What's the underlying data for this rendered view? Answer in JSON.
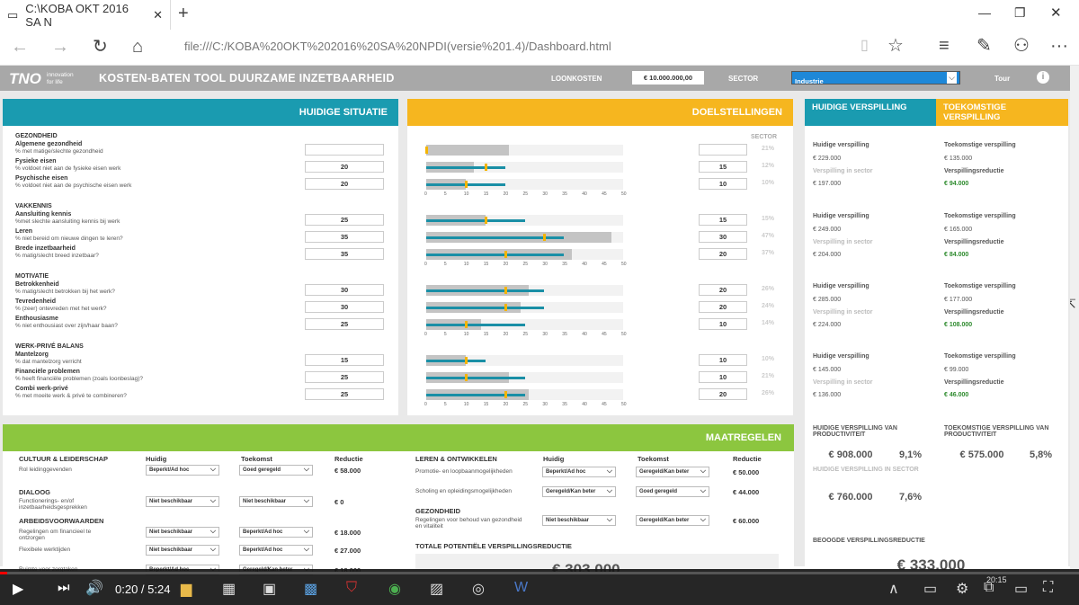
{
  "browser": {
    "tab_title": "C:\\KOBA OKT 2016 SA N",
    "url": "file:///C:/KOBA%20OKT%202016%20SA%20NPDI(versie%201.4)/Dashboard.html"
  },
  "header": {
    "logo": "TNO",
    "logo_sub1": "innovation",
    "logo_sub2": "for life",
    "title": "KOSTEN-BATEN TOOL DUURZAME INZETBAARHEID",
    "loonkosten_label": "LOONKOSTEN",
    "loonkosten_value": "€ 10.000.000,00",
    "sector_label": "SECTOR",
    "sector_value": "Industrie",
    "tour": "Tour"
  },
  "colors": {
    "teal": "#1a9bb0",
    "orange": "#f6b61f",
    "green": "#8cc63f"
  },
  "left": {
    "title": "HUIDIGE SITUATIE"
  },
  "mid": {
    "title": "DOELSTELLINGEN",
    "sector_label": "SECTOR"
  },
  "sections": [
    {
      "name": "GEZONDHEID",
      "rows": [
        {
          "label": "Algemene gezondheid",
          "sub": "% met matige/slechte gezondheid",
          "huidig": "",
          "doel": "",
          "sector": "21%",
          "grey": 21,
          "teal": 0,
          "mark": 0
        },
        {
          "label": "Fysieke eisen",
          "sub": "% voldoet niet aan de fysieke eisen werk",
          "huidig": "20",
          "doel": "15",
          "sector": "12%",
          "grey": 12,
          "teal": 20,
          "mark": 15
        },
        {
          "label": "Psychische eisen",
          "sub": "% voldoet niet aan de psychische eisen werk",
          "huidig": "20",
          "doel": "10",
          "sector": "10%",
          "grey": 10,
          "teal": 20,
          "mark": 10
        }
      ]
    },
    {
      "name": "VAKKENNIS",
      "rows": [
        {
          "label": "Aansluiting kennis",
          "sub": "%met slechte aansluiting kennis bij werk",
          "huidig": "25",
          "doel": "15",
          "sector": "15%",
          "grey": 15,
          "teal": 25,
          "mark": 15
        },
        {
          "label": "Leren",
          "sub": "% niet bereid om nieuwe dingen te leren?",
          "huidig": "35",
          "doel": "30",
          "sector": "47%",
          "grey": 47,
          "teal": 35,
          "mark": 30
        },
        {
          "label": "Brede inzetbaarheid",
          "sub": "% matig/slecht breed inzetbaar?",
          "huidig": "35",
          "doel": "20",
          "sector": "37%",
          "grey": 37,
          "teal": 35,
          "mark": 20
        }
      ]
    },
    {
      "name": "MOTIVATIE",
      "rows": [
        {
          "label": "Betrokkenheid",
          "sub": "% matig/slecht betrokken bij het werk?",
          "huidig": "30",
          "doel": "20",
          "sector": "26%",
          "grey": 26,
          "teal": 30,
          "mark": 20
        },
        {
          "label": "Tevredenheid",
          "sub": "% (zeer) ontevreden met het werk?",
          "huidig": "30",
          "doel": "20",
          "sector": "24%",
          "grey": 24,
          "teal": 30,
          "mark": 20
        },
        {
          "label": "Enthousiasme",
          "sub": "% niet enthousiast over zijn/haar baan?",
          "huidig": "25",
          "doel": "10",
          "sector": "14%",
          "grey": 14,
          "teal": 25,
          "mark": 10
        }
      ]
    },
    {
      "name": "WERK-PRIVÉ BALANS",
      "rows": [
        {
          "label": "Mantelzorg",
          "sub": "% dat mantelzorg verricht",
          "huidig": "15",
          "doel": "10",
          "sector": "10%",
          "grey": 10,
          "teal": 15,
          "mark": 10
        },
        {
          "label": "Financiële problemen",
          "sub": "% heeft financiële problemen (zoals loonbeslag)?",
          "huidig": "25",
          "doel": "10",
          "sector": "21%",
          "grey": 21,
          "teal": 25,
          "mark": 10
        },
        {
          "label": "Combi werk-privé",
          "sub": "% met moeite werk & privé te combineren?",
          "huidig": "25",
          "doel": "20",
          "sector": "26%",
          "grey": 26,
          "teal": 25,
          "mark": 20
        }
      ]
    }
  ],
  "axis": [
    "0",
    "5",
    "10",
    "15",
    "20",
    "25",
    "30",
    "35",
    "40",
    "45",
    "50"
  ],
  "right": {
    "title_huidig": "HUIDIGE VERSPILLING",
    "title_toek": "TOEKOMSTIGE VERSPILLING",
    "blocks": [
      {
        "h_label": "Huidige verspilling",
        "h_val": "€ 229.000",
        "s_label": "Verspilling in sector",
        "s_val": "€ 197.000",
        "t_label": "Toekomstige verspilling",
        "t_val": "€ 135.000",
        "r_label": "Verspillingsreductie",
        "r_val": "€ 94.000"
      },
      {
        "h_label": "Huidige verspilling",
        "h_val": "€ 249.000",
        "s_label": "Verspilling in sector",
        "s_val": "€ 204.000",
        "t_label": "Toekomstige verspilling",
        "t_val": "€ 165.000",
        "r_label": "Verspillingsreductie",
        "r_val": "€ 84.000"
      },
      {
        "h_label": "Huidige verspilling",
        "h_val": "€ 285.000",
        "s_label": "Verspilling in sector",
        "s_val": "€ 224.000",
        "t_label": "Toekomstige verspilling",
        "t_val": "€ 177.000",
        "r_label": "Verspillingsreductie",
        "r_val": "€ 108.000"
      },
      {
        "h_label": "Huidige verspilling",
        "h_val": "€ 145.000",
        "s_label": "Verspilling in sector",
        "s_val": "€ 136.000",
        "t_label": "Toekomstige verspilling",
        "t_val": "€ 99.000",
        "r_label": "Verspillingsreductie",
        "r_val": "€ 46.000"
      }
    ],
    "prod_h_title": "HUIDIGE VERSPILLING VAN PRODUCTIVITEIT",
    "prod_h_val": "€ 908.000",
    "prod_h_pct": "9,1%",
    "prod_t_title": "TOEKOMSTIGE VERSPILLING VAN PRODUCTIVITEIT",
    "prod_t_val": "€ 575.000",
    "prod_t_pct": "5,8%",
    "prod_s_title": "HUIDIGE VERSPILLING IN SECTOR",
    "prod_s_val": "€ 760.000",
    "prod_s_pct": "7,6%",
    "beoogd_title": "BEOOGDE VERSPILLINGSREDUCTIE",
    "beoogd_val": "€ 333.000"
  },
  "maatregelen": {
    "title": "MAATREGELEN",
    "col_huidig": "Huidig",
    "col_toekomst": "Toekomst",
    "col_reductie": "Reductie",
    "left": [
      {
        "cat": "CULTUUR & LEIDERSCHAP"
      },
      {
        "text": "Rol leidinggevenden",
        "h": "Beperkt/Ad hoc",
        "t": "Goed geregeld",
        "r": "€ 58.000"
      },
      {
        "cat": "DIALOOG"
      },
      {
        "text": "Functionerings- en/of inzetbaarheidsgesprekken",
        "h": "Niet beschikbaar",
        "t": "Niet beschikbaar",
        "r": "€ 0"
      },
      {
        "cat": "ARBEIDSVOORWAARDEN"
      },
      {
        "text": "Regelingen om financieel te ontzorgen",
        "h": "Niet beschikbaar",
        "t": "Beperkt/Ad hoc",
        "r": "€ 18.000"
      },
      {
        "text": "Flexibele werktijden",
        "h": "Niet beschikbaar",
        "t": "Beperkt/Ad hoc",
        "r": "€ 27.000"
      },
      {
        "text": "Ruimte voor zorgtaken",
        "h": "Beperkt/Ad hoc",
        "t": "Geregeld/Kan beter",
        "r": "€ 18.000"
      }
    ],
    "right_cat": "LEREN & ONTWIKKELEN",
    "right": [
      {
        "text": "Promotie- en loopbaanmogelijkheden",
        "h": "Beperkt/Ad hoc",
        "t": "Geregeld/Kan beter",
        "r": "€ 50.000"
      },
      {
        "text": "Scholing en opleidingsmogelijkheden",
        "h": "Geregeld/Kan beter",
        "t": "Goed geregeld",
        "r": "€ 44.000"
      }
    ],
    "right_cat2": "GEZONDHEID",
    "right2": [
      {
        "text": "Regelingen voor behoud van gezondheid en vitaliteit",
        "h": "Niet beschikbaar",
        "t": "Geregeld/Kan beter",
        "r": "€ 60.000"
      }
    ],
    "totaal_label": "TOTALE POTENTIËLE VERSPILLINGSREDUCTIE",
    "totaal_val": "€ 303.000"
  },
  "video": {
    "time": "0:20 / 5:24",
    "clock": "20:15"
  }
}
